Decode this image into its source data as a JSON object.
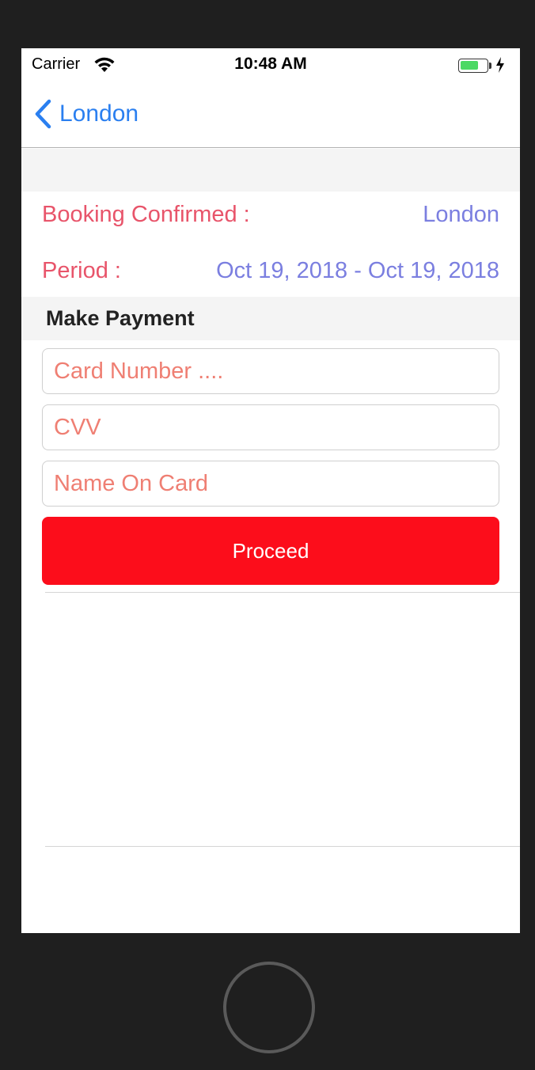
{
  "status_bar": {
    "carrier": "Carrier",
    "time": "10:48 AM",
    "battery_level": 0.6,
    "charging": true
  },
  "nav": {
    "back_label": "London"
  },
  "booking": {
    "confirmed_label": "Booking Confirmed :",
    "confirmed_value": "London",
    "period_label": "Period :",
    "period_value": "Oct 19, 2018 - Oct 19, 2018"
  },
  "payment": {
    "header": "Make Payment",
    "card_number_placeholder": "Card Number ....",
    "cvv_placeholder": "CVV",
    "name_placeholder": "Name On Card",
    "proceed_label": "Proceed"
  },
  "colors": {
    "accent_blue": "#2a7ff0",
    "label_red": "#e8546a",
    "value_blue": "#7b7fe0",
    "placeholder": "#ef7f73",
    "button_red": "#fc0d1b"
  }
}
